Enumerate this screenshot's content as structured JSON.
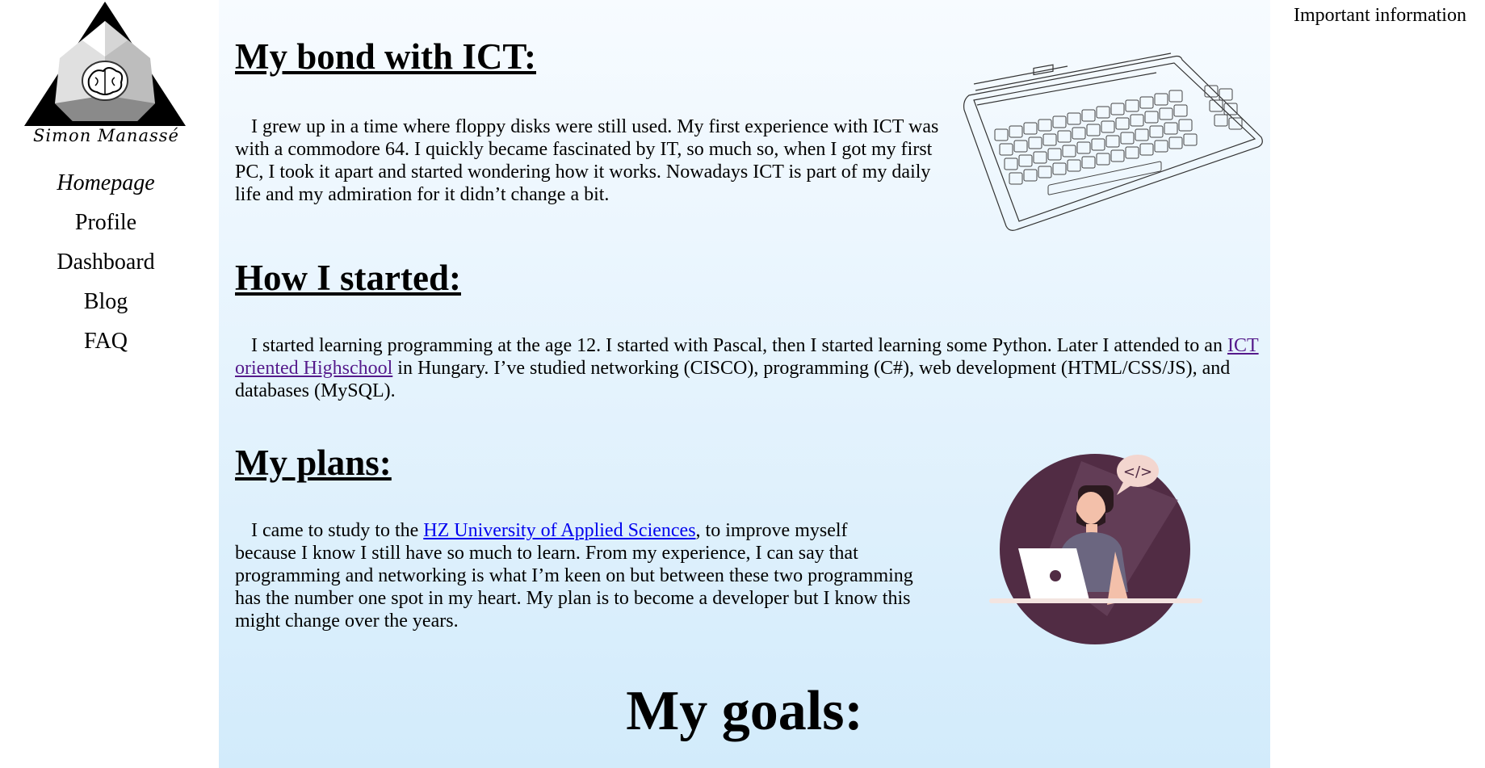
{
  "sidebar": {
    "logo_name": "Simon Manassé",
    "nav": [
      {
        "label": "Homepage"
      },
      {
        "label": "Profile"
      },
      {
        "label": "Dashboard"
      },
      {
        "label": "Blog"
      },
      {
        "label": "FAQ"
      }
    ]
  },
  "main": {
    "bond": {
      "title": "My bond with ICT:",
      "text": "I grew up in a time where floppy disks were still used. My first experience with ICT was with a commodore 64. I quickly became fascinated by IT, so much so, when I got my first PC, I took it apart and started wondering how it works. Nowadays ICT is part of my daily life and my admiration for it didn’t change a bit."
    },
    "started": {
      "title": "How I started:",
      "text_before": "I started learning programming at the age 12. I started with Pascal, then I started learning some Python. Later I attended to an ",
      "link": "ICT oriented Highschool",
      "text_after": " in Hungary. I’ve studied networking (CISCO), programming (C#), web development (HTML/CSS/JS), and databases (MySQL)."
    },
    "plans": {
      "title": "My plans:",
      "text_before": "I came to study to the ",
      "link": "HZ University of Applied Sciences",
      "text_after": ", to improve myself because I know I still have so much to learn. From my experience, I can say that programming and networking is what I’m keen on but between these two programming has the number one spot in my heart. My plan is to become a developer but I know this might change over the years."
    },
    "goals": {
      "title": "My goals:"
    },
    "illustration": {
      "bubble_text": "</>"
    }
  },
  "aside": {
    "title": "Important information"
  },
  "colors": {
    "link": "#0000ee",
    "link_visited": "#551a8b",
    "illustration_circle": "#512c44",
    "gradient_top": "#f7fbff",
    "gradient_bottom": "#d2ebfb"
  }
}
